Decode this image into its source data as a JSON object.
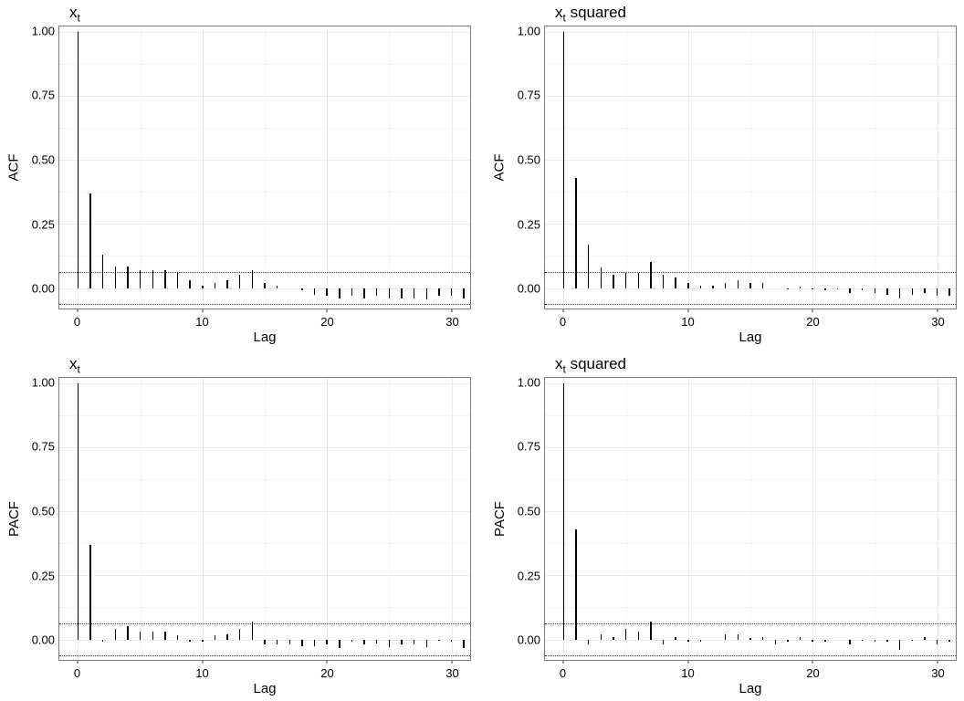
{
  "chart_data": [
    {
      "id": "tl",
      "type": "bar",
      "title_html": "x<sub>t</sub>",
      "xlabel": "Lag",
      "ylabel": "ACF",
      "ylim": [
        -0.08,
        1.02
      ],
      "yticks": [
        0.0,
        0.25,
        0.5,
        0.75,
        1.0
      ],
      "ytick_labels": [
        "0.00",
        "0.25",
        "0.50",
        "0.75",
        "1.00"
      ],
      "xlim": [
        -1.5,
        31.5
      ],
      "xticks": [
        0,
        10,
        20,
        30
      ],
      "xtick_labels": [
        "0",
        "10",
        "20",
        "30"
      ],
      "ci": 0.062,
      "lags": [
        0,
        1,
        2,
        3,
        4,
        5,
        6,
        7,
        8,
        9,
        10,
        11,
        12,
        13,
        14,
        15,
        16,
        17,
        18,
        19,
        20,
        21,
        22,
        23,
        24,
        25,
        26,
        27,
        28,
        29,
        30,
        31
      ],
      "values": [
        1.0,
        0.37,
        0.13,
        0.085,
        0.085,
        0.07,
        0.07,
        0.07,
        0.06,
        0.03,
        0.01,
        0.02,
        0.03,
        0.05,
        0.07,
        0.02,
        0.01,
        0.0,
        -0.01,
        -0.025,
        -0.03,
        -0.04,
        -0.03,
        -0.04,
        -0.03,
        -0.04,
        -0.04,
        -0.04,
        -0.045,
        -0.03,
        -0.03,
        -0.04
      ]
    },
    {
      "id": "tr",
      "type": "bar",
      "title_html": "x<sub>t</sub> squared",
      "xlabel": "Lag",
      "ylabel": "ACF",
      "ylim": [
        -0.08,
        1.02
      ],
      "yticks": [
        0.0,
        0.25,
        0.5,
        0.75,
        1.0
      ],
      "ytick_labels": [
        "0.00",
        "0.25",
        "0.50",
        "0.75",
        "1.00"
      ],
      "xlim": [
        -1.5,
        31.5
      ],
      "xticks": [
        0,
        10,
        20,
        30
      ],
      "xtick_labels": [
        "0",
        "10",
        "20",
        "30"
      ],
      "ci": 0.062,
      "lags": [
        0,
        1,
        2,
        3,
        4,
        5,
        6,
        7,
        8,
        9,
        10,
        11,
        12,
        13,
        14,
        15,
        16,
        17,
        18,
        19,
        20,
        21,
        22,
        23,
        24,
        25,
        26,
        27,
        28,
        29,
        30,
        31
      ],
      "values": [
        1.0,
        0.43,
        0.17,
        0.08,
        0.05,
        0.06,
        0.06,
        0.1,
        0.05,
        0.04,
        0.02,
        0.01,
        0.01,
        0.02,
        0.03,
        0.02,
        0.02,
        0.0,
        -0.005,
        0.005,
        -0.005,
        -0.01,
        -0.005,
        -0.02,
        -0.01,
        -0.02,
        -0.025,
        -0.04,
        -0.025,
        -0.02,
        -0.03,
        -0.03
      ]
    },
    {
      "id": "bl",
      "type": "bar",
      "title_html": "x<sub>t</sub>",
      "xlabel": "Lag",
      "ylabel": "PACF",
      "ylim": [
        -0.08,
        1.02
      ],
      "yticks": [
        0.0,
        0.25,
        0.5,
        0.75,
        1.0
      ],
      "ytick_labels": [
        "0.00",
        "0.25",
        "0.50",
        "0.75",
        "1.00"
      ],
      "xlim": [
        -1.5,
        31.5
      ],
      "xticks": [
        0,
        10,
        20,
        30
      ],
      "xtick_labels": [
        "0",
        "10",
        "20",
        "30"
      ],
      "ci": 0.062,
      "lags": [
        0,
        1,
        2,
        3,
        4,
        5,
        6,
        7,
        8,
        9,
        10,
        11,
        12,
        13,
        14,
        15,
        16,
        17,
        18,
        19,
        20,
        21,
        22,
        23,
        24,
        25,
        26,
        27,
        28,
        29,
        30,
        31
      ],
      "values": [
        1.0,
        0.37,
        -0.01,
        0.04,
        0.05,
        0.03,
        0.03,
        0.03,
        0.015,
        -0.01,
        -0.01,
        0.015,
        0.02,
        0.04,
        0.07,
        -0.02,
        -0.02,
        -0.02,
        -0.025,
        -0.025,
        -0.02,
        -0.035,
        -0.01,
        -0.02,
        -0.015,
        -0.03,
        -0.02,
        -0.02,
        -0.03,
        -0.005,
        -0.01,
        -0.035
      ]
    },
    {
      "id": "br",
      "type": "bar",
      "title_html": "x<sub>t</sub> squared",
      "xlabel": "Lag",
      "ylabel": "PACF",
      "ylim": [
        -0.08,
        1.02
      ],
      "yticks": [
        0.0,
        0.25,
        0.5,
        0.75,
        1.0
      ],
      "ytick_labels": [
        "0.00",
        "0.25",
        "0.50",
        "0.75",
        "1.00"
      ],
      "xlim": [
        -1.5,
        31.5
      ],
      "xticks": [
        0,
        10,
        20,
        30
      ],
      "xtick_labels": [
        "0",
        "10",
        "20",
        "30"
      ],
      "ci": 0.062,
      "lags": [
        0,
        1,
        2,
        3,
        4,
        5,
        6,
        7,
        8,
        9,
        10,
        11,
        12,
        13,
        14,
        15,
        16,
        17,
        18,
        19,
        20,
        21,
        22,
        23,
        24,
        25,
        26,
        27,
        28,
        29,
        30,
        31
      ],
      "values": [
        1.0,
        0.43,
        -0.02,
        0.02,
        0.01,
        0.04,
        0.03,
        0.07,
        -0.02,
        0.01,
        -0.01,
        -0.01,
        0.0,
        0.02,
        0.02,
        0.005,
        0.01,
        -0.02,
        -0.01,
        0.01,
        -0.01,
        -0.01,
        0.0,
        -0.02,
        -0.005,
        -0.01,
        -0.01,
        -0.04,
        -0.005,
        0.01,
        -0.02,
        -0.01
      ]
    }
  ]
}
